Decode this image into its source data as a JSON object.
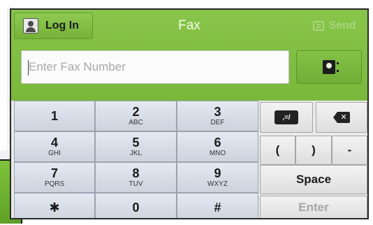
{
  "header": {
    "login_label": "Log In",
    "title": "Fax",
    "send_label": "Send"
  },
  "fax_input": {
    "placeholder": "Enter Fax Number",
    "value": ""
  },
  "keypad": {
    "keys": [
      {
        "digit": "1",
        "letters": ""
      },
      {
        "digit": "2",
        "letters": "ABC"
      },
      {
        "digit": "3",
        "letters": "DEF"
      },
      {
        "digit": "4",
        "letters": "GHI"
      },
      {
        "digit": "5",
        "letters": "JKL"
      },
      {
        "digit": "6",
        "letters": "MNO"
      },
      {
        "digit": "7",
        "letters": "PQRS"
      },
      {
        "digit": "8",
        "letters": "TUV"
      },
      {
        "digit": "9",
        "letters": "WXYZ"
      },
      {
        "digit": "✱",
        "letters": ""
      },
      {
        "digit": "0",
        "letters": ""
      },
      {
        "digit": "#",
        "letters": ""
      }
    ]
  },
  "controls": {
    "symbols_label": ",=/",
    "backspace_glyph": "✕",
    "open_paren": "(",
    "close_paren": ")",
    "dash": "-",
    "space_label": "Space",
    "enter_label": "Enter"
  },
  "icons": {
    "login": "user-icon",
    "send": "fax-send-icon",
    "address_book": "address-book-icon",
    "backspace": "backspace-icon",
    "symbols": "symbols-icon"
  },
  "colors": {
    "header_green": "#7ab83c",
    "key_blue_gray": "#d5dbe5",
    "send_disabled": "#a9d47f",
    "enter_disabled": "#a5a5a5"
  }
}
